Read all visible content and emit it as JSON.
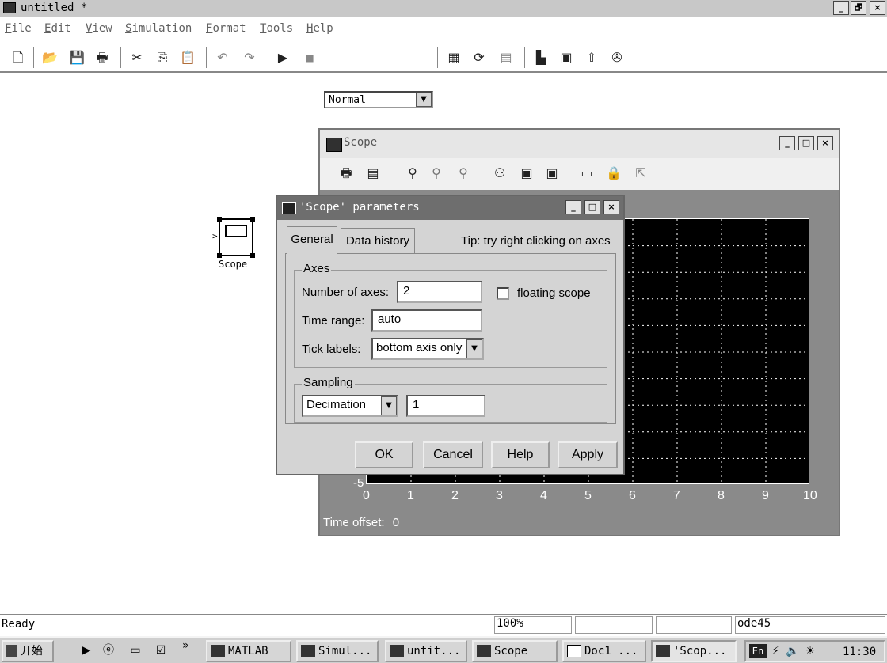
{
  "main_window": {
    "title": "untitled *",
    "controls": [
      "_",
      "🗗",
      "×"
    ]
  },
  "menu": [
    "File",
    "Edit",
    "View",
    "Simulation",
    "Format",
    "Tools",
    "Help"
  ],
  "toolbar": {
    "sim_mode": "Normal",
    "icons": [
      "new-icon",
      "open-icon",
      "save-icon",
      "print-icon",
      "cut-icon",
      "copy-icon",
      "paste-icon",
      "undo-icon",
      "redo-icon",
      "start-icon",
      "stop-icon",
      "build-icon",
      "update-icon",
      "library-icon",
      "model-browser-icon",
      "debug-icon",
      "up-icon",
      "explorer-icon"
    ]
  },
  "block": {
    "label": "Scope"
  },
  "scope_window": {
    "title": "Scope",
    "controls": [
      "_",
      "□",
      "×"
    ],
    "x_ticks": [
      "0",
      "1",
      "2",
      "3",
      "4",
      "5",
      "6",
      "7",
      "8",
      "9",
      "10"
    ],
    "y_min_label": "-5",
    "time_offset_label": "Time offset:",
    "time_offset_value": "0"
  },
  "dialog": {
    "title": "'Scope' parameters",
    "controls": [
      "_",
      "□",
      "×"
    ],
    "tabs": [
      "General",
      "Data history"
    ],
    "tip": "Tip: try right clicking on axes",
    "axes_group": "Axes",
    "num_axes_label": "Number of axes:",
    "num_axes_value": "2",
    "floating_scope_label": "floating scope",
    "floating_scope_checked": false,
    "time_range_label": "Time range:",
    "time_range_value": "auto",
    "tick_labels_label": "Tick labels:",
    "tick_labels_value": "bottom axis only",
    "sampling_group": "Sampling",
    "sampling_mode": "Decimation",
    "sampling_value": "1",
    "buttons": {
      "ok": "OK",
      "cancel": "Cancel",
      "help": "Help",
      "apply": "Apply"
    }
  },
  "status": {
    "text": "Ready",
    "zoom": "100%",
    "solver": "ode45"
  },
  "taskbar": {
    "start": "开始",
    "chevron": "»",
    "tasks": [
      "MATLAB",
      "Simul...",
      "untit...",
      "Scope",
      "Doc1 ...",
      "'Scop..."
    ],
    "lang": "En",
    "clock": "11:30"
  }
}
